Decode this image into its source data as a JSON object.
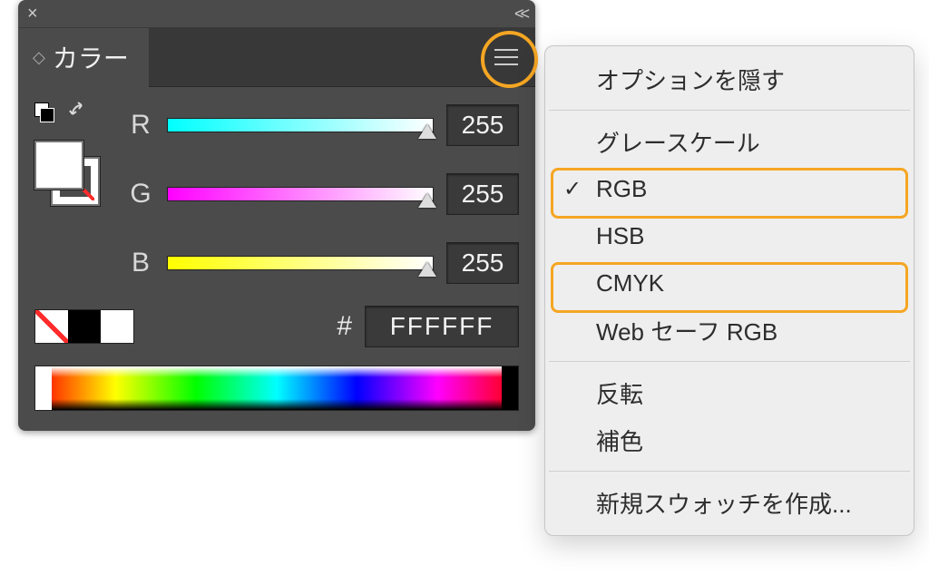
{
  "panel": {
    "tab_title": "カラー",
    "sliders": {
      "r": {
        "label": "R",
        "value": "255"
      },
      "g": {
        "label": "G",
        "value": "255"
      },
      "b": {
        "label": "B",
        "value": "255"
      }
    },
    "hex_prefix": "#",
    "hex_value": "FFFFFF"
  },
  "menu": {
    "hide_options": "オプションを隠す",
    "grayscale": "グレースケール",
    "rgb": "RGB",
    "hsb": "HSB",
    "cmyk": "CMYK",
    "websafe": "Web セーフ RGB",
    "invert": "反転",
    "complement": "補色",
    "new_swatch": "新規スウォッチを作成...",
    "checked": "rgb"
  },
  "colors": {
    "highlight": "#f5a623"
  }
}
